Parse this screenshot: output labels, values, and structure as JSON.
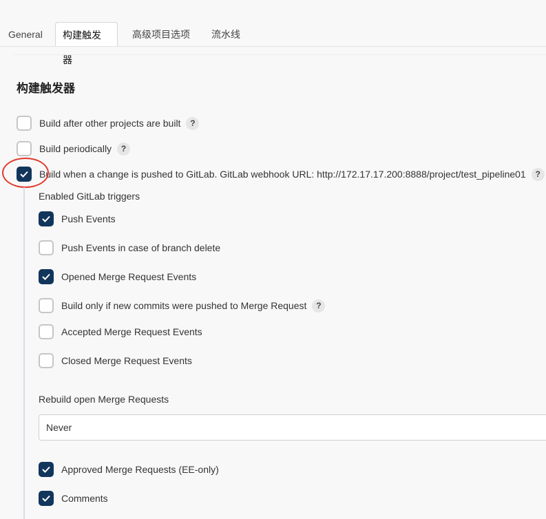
{
  "tabs": [
    {
      "label": "General",
      "active": false
    },
    {
      "label": "构建触发器",
      "active": true
    },
    {
      "label": "高级项目选项",
      "active": false
    },
    {
      "label": "流水线",
      "active": false
    }
  ],
  "section": {
    "title": "构建触发器"
  },
  "triggers": [
    {
      "label": "Build after other projects are built",
      "checked": false,
      "help": "?"
    },
    {
      "label": "Build periodically",
      "checked": false,
      "help": "?"
    },
    {
      "label": "Build when a change is pushed to GitLab. GitLab webhook URL: http://172.17.17.200:8888/project/test_pipeline01",
      "checked": true,
      "help": "?"
    }
  ],
  "gitlab": {
    "enabled_triggers_label": "Enabled GitLab triggers",
    "options": [
      {
        "label": "Push Events",
        "checked": true
      },
      {
        "label": "Push Events in case of branch delete",
        "checked": false
      },
      {
        "label": "Opened Merge Request Events",
        "checked": true
      },
      {
        "label": "Build only if new commits were pushed to Merge Request",
        "checked": false,
        "help": "?"
      },
      {
        "label": "Accepted Merge Request Events",
        "checked": false
      },
      {
        "label": "Closed Merge Request Events",
        "checked": false
      }
    ],
    "rebuild_label": "Rebuild open Merge Requests",
    "rebuild_value": "Never",
    "extra_options": [
      {
        "label": "Approved Merge Requests (EE-only)",
        "checked": true
      },
      {
        "label": "Comments",
        "checked": true
      }
    ]
  },
  "colors": {
    "accent": "#12355b",
    "highlight": "#e23a2e"
  }
}
